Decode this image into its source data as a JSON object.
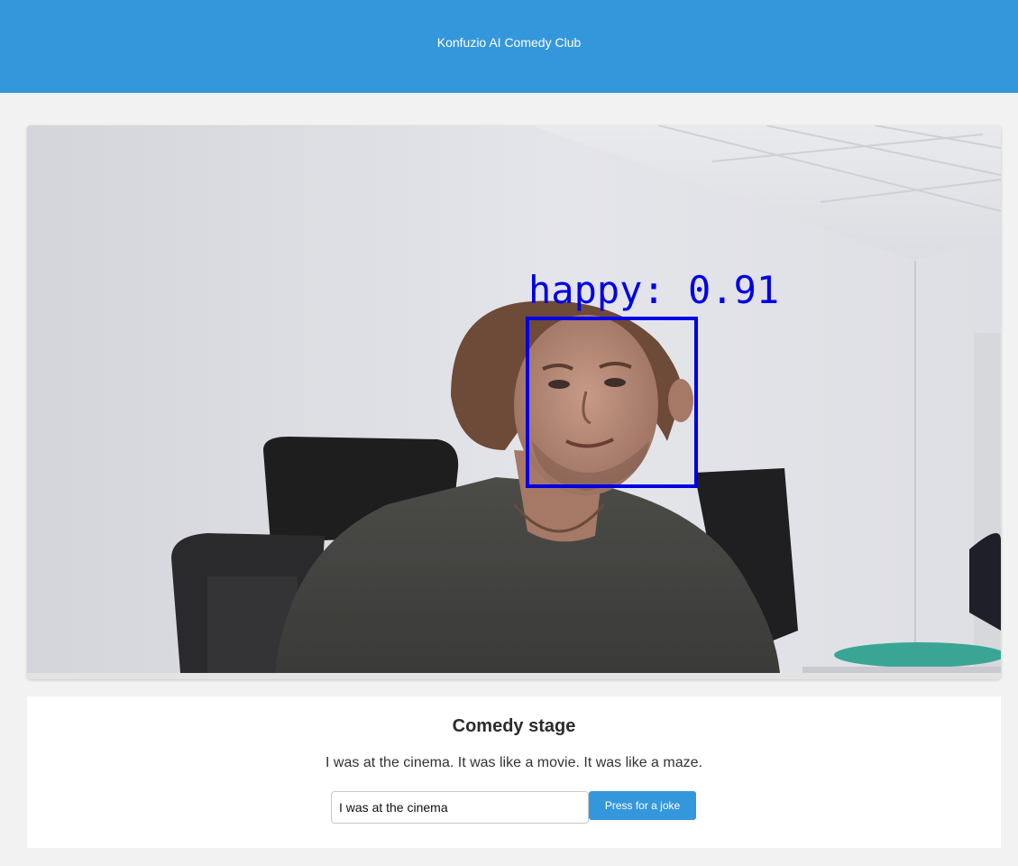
{
  "header": {
    "title": "Konfuzio AI Comedy Club"
  },
  "video": {
    "detection_label": "happy: 0.91",
    "box_color": "#0000e6"
  },
  "stage": {
    "title": "Comedy stage",
    "joke": "I was at the cinema. It was like a movie. It was like a maze.",
    "input_value": "I was at the cinema",
    "button_label": "Press for a joke"
  },
  "colors": {
    "accent": "#3597db",
    "background": "#f2f2f2"
  }
}
